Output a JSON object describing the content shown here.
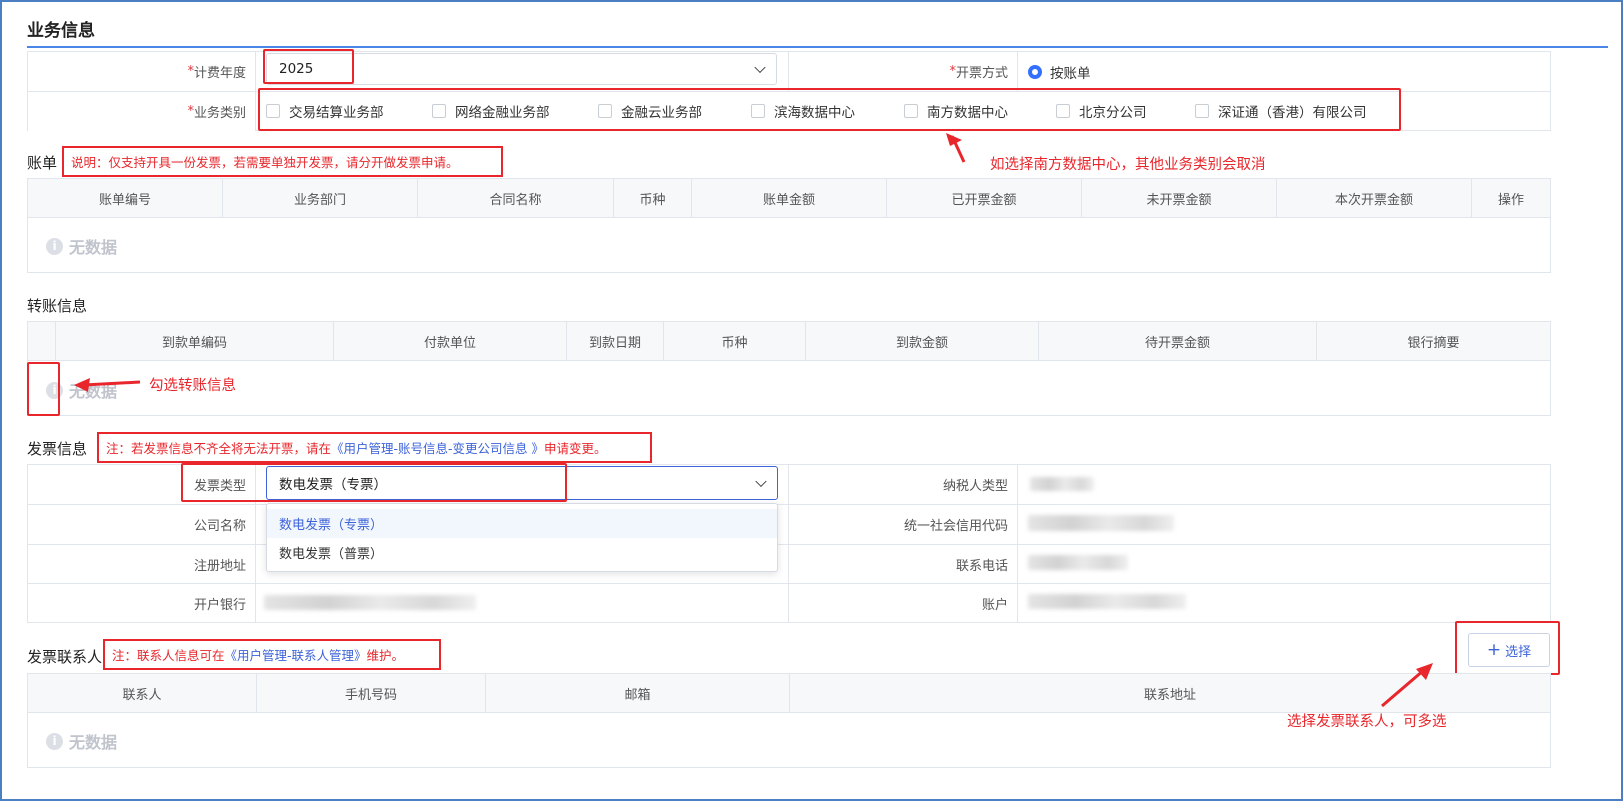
{
  "section_business": {
    "title": "业务信息",
    "year_label": "计费年度",
    "year_value": "2025",
    "invoice_mode_label": "开票方式",
    "invoice_mode_value": "按账单",
    "category_label": "业务类别",
    "categories": [
      "交易结算业务部",
      "网络金融业务部",
      "金融云业务部",
      "滨海数据中心",
      "南方数据中心",
      "北京分公司",
      "深证通（香港）有限公司"
    ],
    "required_mark": "*"
  },
  "bill": {
    "title": "账单",
    "note": "说明：仅支持开具一份发票，若需要单独开发票，请分开做发票申请。",
    "annotation": "如选择南方数据中心，其他业务类别会取消",
    "columns": [
      "账单编号",
      "业务部门",
      "合同名称",
      "币种",
      "账单金额",
      "已开票金额",
      "未开票金额",
      "本次开票金额",
      "操作"
    ],
    "empty_text": "无数据"
  },
  "transfer": {
    "title": "转账信息",
    "columns": [
      "到款单编码",
      "付款单位",
      "到款日期",
      "币种",
      "到款金额",
      "待开票金额",
      "银行摘要"
    ],
    "empty_text": "无数据",
    "annotation": "勾选转账信息"
  },
  "invoice": {
    "title": "发票信息",
    "note_prefix": "注：若发票信息不齐全将无法开票，请在",
    "note_link": "《用户管理-账号信息-变更公司信息 》",
    "note_suffix": "申请变更。",
    "type_label": "发票类型",
    "type_value": "数电发票（专票）",
    "type_options": [
      "数电发票（专票）",
      "数电发票（普票）"
    ],
    "company_label": "公司名称",
    "address_label": "注册地址",
    "bank_label": "开户银行",
    "taxpayer_label": "纳税人类型",
    "credit_code_label": "统一社会信用代码",
    "phone_label": "联系电话",
    "account_label": "账户"
  },
  "contacts": {
    "title": "发票联系人",
    "note_prefix": "注：联系人信息可在",
    "note_link": "《用户管理-联系人管理》",
    "note_suffix": "维护。",
    "select_button": "选择",
    "columns": [
      "联系人",
      "手机号码",
      "邮箱",
      "联系地址"
    ],
    "empty_text": "无数据",
    "annotation": "选择发票联系人，可多选"
  },
  "colors": {
    "accent": "#3370ff",
    "annotation_red": "#e8262b",
    "link_blue": "#3d63d9"
  },
  "icons": [
    "chevron-down-icon",
    "radio-checked-icon",
    "checkbox-icon",
    "info-icon",
    "plus-icon",
    "arrow-icon"
  ]
}
